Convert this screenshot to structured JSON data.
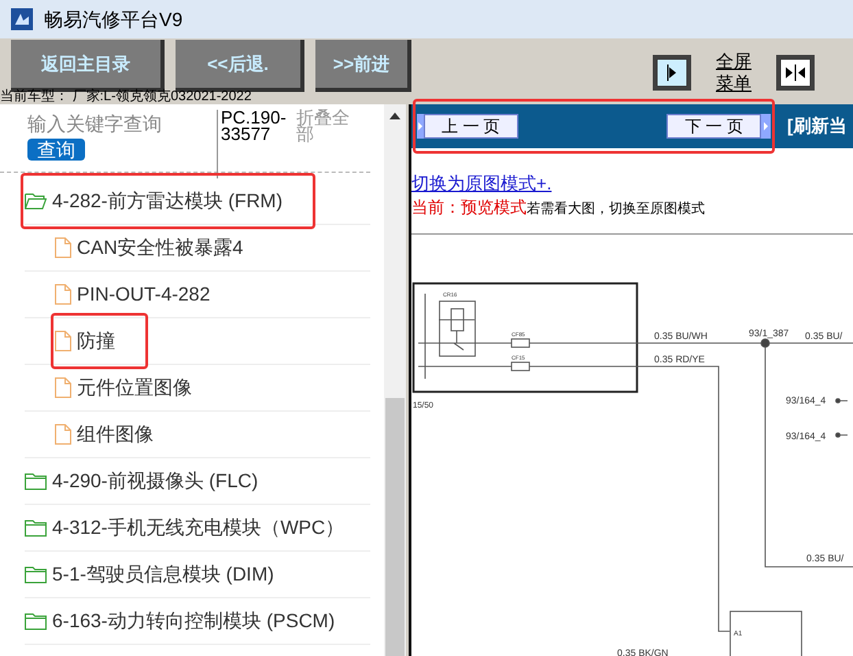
{
  "window": {
    "title": "畅易汽修平台V9"
  },
  "toolbar": {
    "buttons": [
      "返回主目录",
      "<<后退.",
      ">>前进"
    ],
    "fullscreen_menu": [
      "全屏",
      "菜单"
    ]
  },
  "vehicle": {
    "label": "当前车型：",
    "value": "厂家:L-领克领克032021-2022"
  },
  "search": {
    "placeholder": "输入关键字查询",
    "button": "查询",
    "code": "PC.190-33577",
    "collapse": "折叠全部"
  },
  "tree": [
    {
      "kind": "folder",
      "label": "4-282-前方雷达模块 (FRM)",
      "expanded": true,
      "annotated": true,
      "children": [
        {
          "kind": "file",
          "label": "CAN安全性被暴露4",
          "annotated": false
        },
        {
          "kind": "file",
          "label": "PIN-OUT-4-282",
          "annotated": false
        },
        {
          "kind": "file",
          "label": "防撞",
          "annotated": true
        },
        {
          "kind": "file",
          "label": "元件位置图像",
          "annotated": false
        },
        {
          "kind": "file",
          "label": "组件图像",
          "annotated": false
        }
      ]
    },
    {
      "kind": "folder",
      "label": "4-290-前视摄像头 (FLC)",
      "expanded": false,
      "annotated": false
    },
    {
      "kind": "folder",
      "label": "4-312-手机无线充电模块（WPC）",
      "expanded": false,
      "annotated": false
    },
    {
      "kind": "folder",
      "label": "5-1-驾驶员信息模块 (DIM)",
      "expanded": false,
      "annotated": false
    },
    {
      "kind": "folder",
      "label": "6-163-动力转向控制模块 (PSCM)",
      "expanded": false,
      "annotated": false
    }
  ],
  "pager": {
    "prev": "上 一 页",
    "next": "下 一 页",
    "refresh": "[刷新当",
    "annotated": true
  },
  "document": {
    "link": "切换为原图模式+.",
    "mode_label": "当前：",
    "mode": "预览模式",
    "hint": "若需看大图，切换至原图模式"
  },
  "diagram": {
    "labels": [
      "CR16",
      "CF85",
      "CF15",
      "15/50",
      "0.35  BU/WH",
      "0.35  RD/YE",
      "93/1_387",
      "0.35  BU/",
      "93/164_4",
      "93/164_4",
      "0.35  BU/",
      "A1",
      "0.35  BK/GN"
    ]
  }
}
